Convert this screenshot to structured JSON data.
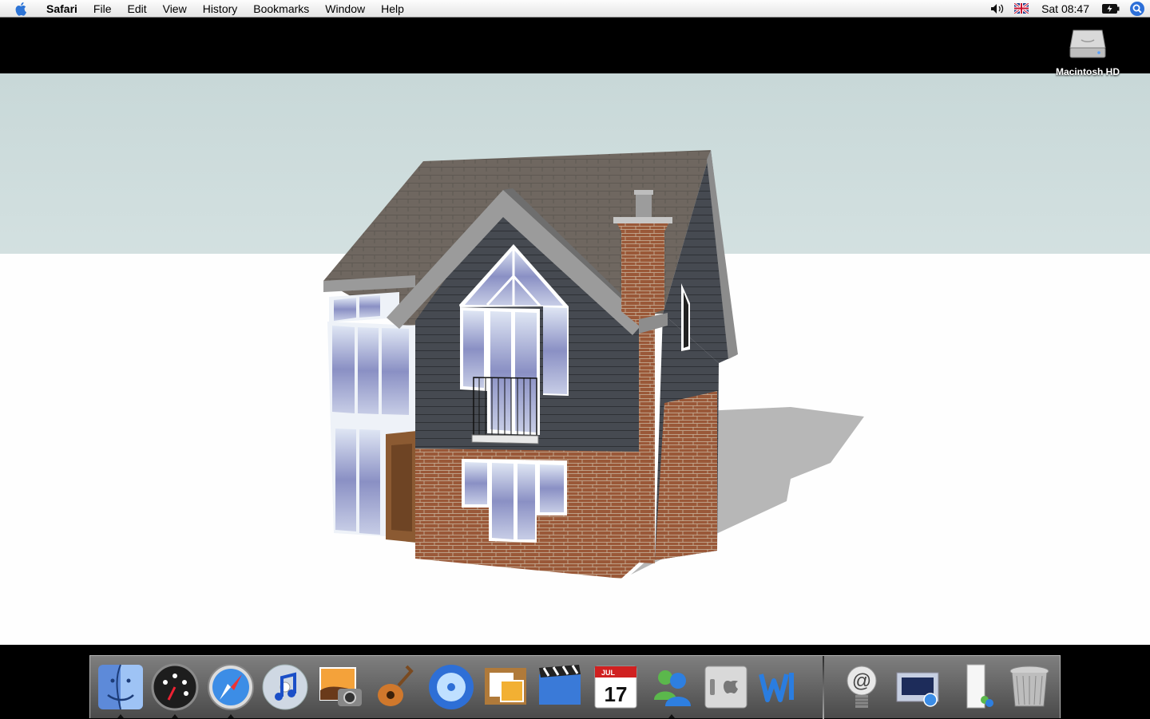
{
  "menubar": {
    "app_name": "Safari",
    "items": [
      "File",
      "Edit",
      "View",
      "History",
      "Bookmarks",
      "Window",
      "Help"
    ],
    "clock": "Sat 08:47",
    "icons": [
      "apple-icon",
      "volume-icon",
      "uk-flag-icon",
      "battery-icon",
      "spotlight-icon"
    ]
  },
  "desktop": {
    "hd_label": "Macintosh HD"
  },
  "dock": {
    "calendar_month": "JUL",
    "calendar_day": "17",
    "apps": [
      "Finder",
      "Dashboard",
      "Safari",
      "iTunes",
      "iPhoto",
      "GarageBand",
      "DVD Player",
      "Preview",
      "iMovie",
      "iCal",
      "MSN Messenger",
      "System Preferences",
      "Word",
      "Mail",
      "Screenshot",
      "Document",
      "Trash"
    ]
  },
  "colors": {
    "sky_top": "#c8d8d8",
    "ground": "#fefefe",
    "roof": "#706860",
    "cladding": "#474b52",
    "brick": "#9a5a3c"
  }
}
